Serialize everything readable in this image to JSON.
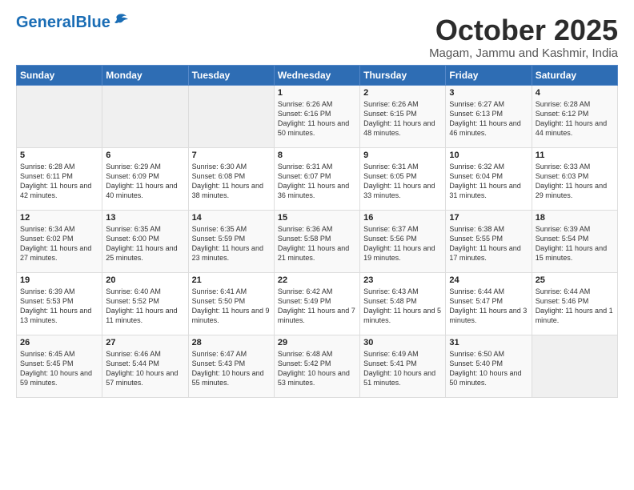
{
  "header": {
    "logo_general": "General",
    "logo_blue": "Blue",
    "month": "October 2025",
    "location": "Magam, Jammu and Kashmir, India"
  },
  "weekdays": [
    "Sunday",
    "Monday",
    "Tuesday",
    "Wednesday",
    "Thursday",
    "Friday",
    "Saturday"
  ],
  "weeks": [
    [
      {
        "day": "",
        "empty": true
      },
      {
        "day": "",
        "empty": true
      },
      {
        "day": "",
        "empty": true
      },
      {
        "day": "1",
        "sunrise": "6:26 AM",
        "sunset": "6:16 PM",
        "daylight": "11 hours and 50 minutes."
      },
      {
        "day": "2",
        "sunrise": "6:26 AM",
        "sunset": "6:15 PM",
        "daylight": "11 hours and 48 minutes."
      },
      {
        "day": "3",
        "sunrise": "6:27 AM",
        "sunset": "6:13 PM",
        "daylight": "11 hours and 46 minutes."
      },
      {
        "day": "4",
        "sunrise": "6:28 AM",
        "sunset": "6:12 PM",
        "daylight": "11 hours and 44 minutes."
      }
    ],
    [
      {
        "day": "5",
        "sunrise": "6:28 AM",
        "sunset": "6:11 PM",
        "daylight": "11 hours and 42 minutes."
      },
      {
        "day": "6",
        "sunrise": "6:29 AM",
        "sunset": "6:09 PM",
        "daylight": "11 hours and 40 minutes."
      },
      {
        "day": "7",
        "sunrise": "6:30 AM",
        "sunset": "6:08 PM",
        "daylight": "11 hours and 38 minutes."
      },
      {
        "day": "8",
        "sunrise": "6:31 AM",
        "sunset": "6:07 PM",
        "daylight": "11 hours and 36 minutes."
      },
      {
        "day": "9",
        "sunrise": "6:31 AM",
        "sunset": "6:05 PM",
        "daylight": "11 hours and 33 minutes."
      },
      {
        "day": "10",
        "sunrise": "6:32 AM",
        "sunset": "6:04 PM",
        "daylight": "11 hours and 31 minutes."
      },
      {
        "day": "11",
        "sunrise": "6:33 AM",
        "sunset": "6:03 PM",
        "daylight": "11 hours and 29 minutes."
      }
    ],
    [
      {
        "day": "12",
        "sunrise": "6:34 AM",
        "sunset": "6:02 PM",
        "daylight": "11 hours and 27 minutes."
      },
      {
        "day": "13",
        "sunrise": "6:35 AM",
        "sunset": "6:00 PM",
        "daylight": "11 hours and 25 minutes."
      },
      {
        "day": "14",
        "sunrise": "6:35 AM",
        "sunset": "5:59 PM",
        "daylight": "11 hours and 23 minutes."
      },
      {
        "day": "15",
        "sunrise": "6:36 AM",
        "sunset": "5:58 PM",
        "daylight": "11 hours and 21 minutes."
      },
      {
        "day": "16",
        "sunrise": "6:37 AM",
        "sunset": "5:56 PM",
        "daylight": "11 hours and 19 minutes."
      },
      {
        "day": "17",
        "sunrise": "6:38 AM",
        "sunset": "5:55 PM",
        "daylight": "11 hours and 17 minutes."
      },
      {
        "day": "18",
        "sunrise": "6:39 AM",
        "sunset": "5:54 PM",
        "daylight": "11 hours and 15 minutes."
      }
    ],
    [
      {
        "day": "19",
        "sunrise": "6:39 AM",
        "sunset": "5:53 PM",
        "daylight": "11 hours and 13 minutes."
      },
      {
        "day": "20",
        "sunrise": "6:40 AM",
        "sunset": "5:52 PM",
        "daylight": "11 hours and 11 minutes."
      },
      {
        "day": "21",
        "sunrise": "6:41 AM",
        "sunset": "5:50 PM",
        "daylight": "11 hours and 9 minutes."
      },
      {
        "day": "22",
        "sunrise": "6:42 AM",
        "sunset": "5:49 PM",
        "daylight": "11 hours and 7 minutes."
      },
      {
        "day": "23",
        "sunrise": "6:43 AM",
        "sunset": "5:48 PM",
        "daylight": "11 hours and 5 minutes."
      },
      {
        "day": "24",
        "sunrise": "6:44 AM",
        "sunset": "5:47 PM",
        "daylight": "11 hours and 3 minutes."
      },
      {
        "day": "25",
        "sunrise": "6:44 AM",
        "sunset": "5:46 PM",
        "daylight": "11 hours and 1 minute."
      }
    ],
    [
      {
        "day": "26",
        "sunrise": "6:45 AM",
        "sunset": "5:45 PM",
        "daylight": "10 hours and 59 minutes."
      },
      {
        "day": "27",
        "sunrise": "6:46 AM",
        "sunset": "5:44 PM",
        "daylight": "10 hours and 57 minutes."
      },
      {
        "day": "28",
        "sunrise": "6:47 AM",
        "sunset": "5:43 PM",
        "daylight": "10 hours and 55 minutes."
      },
      {
        "day": "29",
        "sunrise": "6:48 AM",
        "sunset": "5:42 PM",
        "daylight": "10 hours and 53 minutes."
      },
      {
        "day": "30",
        "sunrise": "6:49 AM",
        "sunset": "5:41 PM",
        "daylight": "10 hours and 51 minutes."
      },
      {
        "day": "31",
        "sunrise": "6:50 AM",
        "sunset": "5:40 PM",
        "daylight": "10 hours and 50 minutes."
      },
      {
        "day": "",
        "empty": true
      }
    ]
  ]
}
